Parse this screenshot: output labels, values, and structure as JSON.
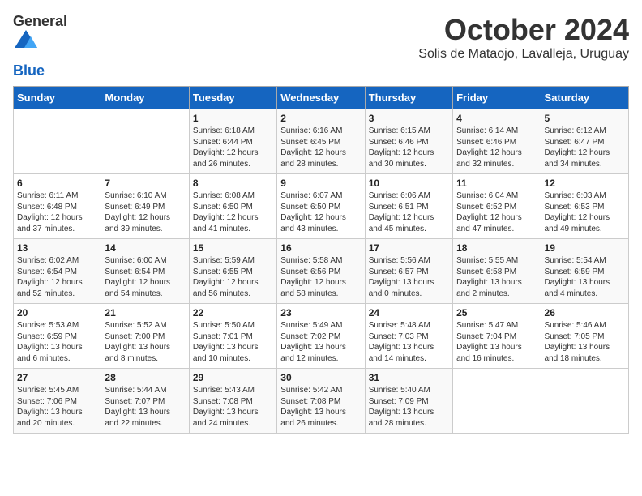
{
  "logo": {
    "text_general": "General",
    "text_blue": "Blue"
  },
  "title": "October 2024",
  "subtitle": "Solis de Mataojo, Lavalleja, Uruguay",
  "days_of_week": [
    "Sunday",
    "Monday",
    "Tuesday",
    "Wednesday",
    "Thursday",
    "Friday",
    "Saturday"
  ],
  "weeks": [
    [
      {
        "day": "",
        "info": ""
      },
      {
        "day": "",
        "info": ""
      },
      {
        "day": "1",
        "info": "Sunrise: 6:18 AM\nSunset: 6:44 PM\nDaylight: 12 hours\nand 26 minutes."
      },
      {
        "day": "2",
        "info": "Sunrise: 6:16 AM\nSunset: 6:45 PM\nDaylight: 12 hours\nand 28 minutes."
      },
      {
        "day": "3",
        "info": "Sunrise: 6:15 AM\nSunset: 6:46 PM\nDaylight: 12 hours\nand 30 minutes."
      },
      {
        "day": "4",
        "info": "Sunrise: 6:14 AM\nSunset: 6:46 PM\nDaylight: 12 hours\nand 32 minutes."
      },
      {
        "day": "5",
        "info": "Sunrise: 6:12 AM\nSunset: 6:47 PM\nDaylight: 12 hours\nand 34 minutes."
      }
    ],
    [
      {
        "day": "6",
        "info": "Sunrise: 6:11 AM\nSunset: 6:48 PM\nDaylight: 12 hours\nand 37 minutes."
      },
      {
        "day": "7",
        "info": "Sunrise: 6:10 AM\nSunset: 6:49 PM\nDaylight: 12 hours\nand 39 minutes."
      },
      {
        "day": "8",
        "info": "Sunrise: 6:08 AM\nSunset: 6:50 PM\nDaylight: 12 hours\nand 41 minutes."
      },
      {
        "day": "9",
        "info": "Sunrise: 6:07 AM\nSunset: 6:50 PM\nDaylight: 12 hours\nand 43 minutes."
      },
      {
        "day": "10",
        "info": "Sunrise: 6:06 AM\nSunset: 6:51 PM\nDaylight: 12 hours\nand 45 minutes."
      },
      {
        "day": "11",
        "info": "Sunrise: 6:04 AM\nSunset: 6:52 PM\nDaylight: 12 hours\nand 47 minutes."
      },
      {
        "day": "12",
        "info": "Sunrise: 6:03 AM\nSunset: 6:53 PM\nDaylight: 12 hours\nand 49 minutes."
      }
    ],
    [
      {
        "day": "13",
        "info": "Sunrise: 6:02 AM\nSunset: 6:54 PM\nDaylight: 12 hours\nand 52 minutes."
      },
      {
        "day": "14",
        "info": "Sunrise: 6:00 AM\nSunset: 6:54 PM\nDaylight: 12 hours\nand 54 minutes."
      },
      {
        "day": "15",
        "info": "Sunrise: 5:59 AM\nSunset: 6:55 PM\nDaylight: 12 hours\nand 56 minutes."
      },
      {
        "day": "16",
        "info": "Sunrise: 5:58 AM\nSunset: 6:56 PM\nDaylight: 12 hours\nand 58 minutes."
      },
      {
        "day": "17",
        "info": "Sunrise: 5:56 AM\nSunset: 6:57 PM\nDaylight: 13 hours\nand 0 minutes."
      },
      {
        "day": "18",
        "info": "Sunrise: 5:55 AM\nSunset: 6:58 PM\nDaylight: 13 hours\nand 2 minutes."
      },
      {
        "day": "19",
        "info": "Sunrise: 5:54 AM\nSunset: 6:59 PM\nDaylight: 13 hours\nand 4 minutes."
      }
    ],
    [
      {
        "day": "20",
        "info": "Sunrise: 5:53 AM\nSunset: 6:59 PM\nDaylight: 13 hours\nand 6 minutes."
      },
      {
        "day": "21",
        "info": "Sunrise: 5:52 AM\nSunset: 7:00 PM\nDaylight: 13 hours\nand 8 minutes."
      },
      {
        "day": "22",
        "info": "Sunrise: 5:50 AM\nSunset: 7:01 PM\nDaylight: 13 hours\nand 10 minutes."
      },
      {
        "day": "23",
        "info": "Sunrise: 5:49 AM\nSunset: 7:02 PM\nDaylight: 13 hours\nand 12 minutes."
      },
      {
        "day": "24",
        "info": "Sunrise: 5:48 AM\nSunset: 7:03 PM\nDaylight: 13 hours\nand 14 minutes."
      },
      {
        "day": "25",
        "info": "Sunrise: 5:47 AM\nSunset: 7:04 PM\nDaylight: 13 hours\nand 16 minutes."
      },
      {
        "day": "26",
        "info": "Sunrise: 5:46 AM\nSunset: 7:05 PM\nDaylight: 13 hours\nand 18 minutes."
      }
    ],
    [
      {
        "day": "27",
        "info": "Sunrise: 5:45 AM\nSunset: 7:06 PM\nDaylight: 13 hours\nand 20 minutes."
      },
      {
        "day": "28",
        "info": "Sunrise: 5:44 AM\nSunset: 7:07 PM\nDaylight: 13 hours\nand 22 minutes."
      },
      {
        "day": "29",
        "info": "Sunrise: 5:43 AM\nSunset: 7:08 PM\nDaylight: 13 hours\nand 24 minutes."
      },
      {
        "day": "30",
        "info": "Sunrise: 5:42 AM\nSunset: 7:08 PM\nDaylight: 13 hours\nand 26 minutes."
      },
      {
        "day": "31",
        "info": "Sunrise: 5:40 AM\nSunset: 7:09 PM\nDaylight: 13 hours\nand 28 minutes."
      },
      {
        "day": "",
        "info": ""
      },
      {
        "day": "",
        "info": ""
      }
    ]
  ]
}
